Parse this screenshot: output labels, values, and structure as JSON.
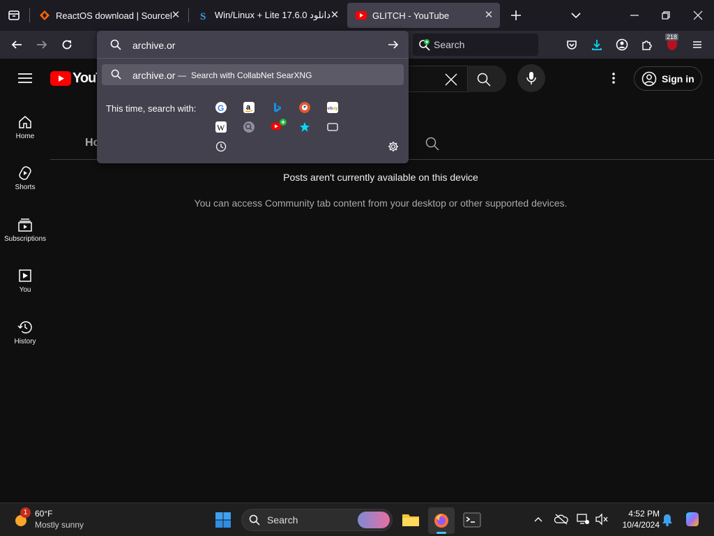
{
  "tabs": [
    {
      "title": "ReactOS download | SourceForge",
      "favicon": "sourceforge-icon",
      "active": false
    },
    {
      "title": "دانلود 17.6.0 Win/Linux + Lite",
      "favicon": "s-icon",
      "active": false
    },
    {
      "title": "GLITCH - YouTube",
      "favicon": "youtube-icon",
      "active": true
    }
  ],
  "navbar": {
    "search_placeholder": "Search",
    "ext_badge": "218"
  },
  "urlbar": {
    "value": "archive.or"
  },
  "dropdown": {
    "result_query": "archive.or",
    "result_dash": "—",
    "result_action": "Search with CollabNet SearXNG",
    "engines_label": "This time, search with:",
    "engines": [
      "google-icon",
      "amazon-icon",
      "bing-icon",
      "duckduckgo-icon",
      "ebay-icon",
      "wikipedia-icon",
      "searx-icon",
      "youtube-add-icon",
      "bookmarks-icon",
      "tabs-icon",
      "history-icon"
    ]
  },
  "youtube": {
    "logo_text": "YouTu",
    "sign_in": "Sign in",
    "tab_partial": "Ho",
    "message_title": "Posts aren't currently available on this device",
    "message_body": "You can access Community tab content from your desktop or other supported devices.",
    "sidebar": [
      {
        "label": "Home",
        "icon": "home-icon"
      },
      {
        "label": "Shorts",
        "icon": "shorts-icon"
      },
      {
        "label": "Subscriptions",
        "icon": "subscriptions-icon"
      },
      {
        "label": "You",
        "icon": "you-icon"
      },
      {
        "label": "History",
        "icon": "history-icon"
      }
    ]
  },
  "taskbar": {
    "weather_temp": "60°F",
    "weather_desc": "Mostly sunny",
    "weather_badge": "1",
    "search_label": "Search",
    "time": "4:52 PM",
    "date": "10/4/2024"
  },
  "colors": {
    "youtube_red": "#ff0000",
    "accent_blue": "#00ddff",
    "taskbar": "#1f1f1f"
  }
}
